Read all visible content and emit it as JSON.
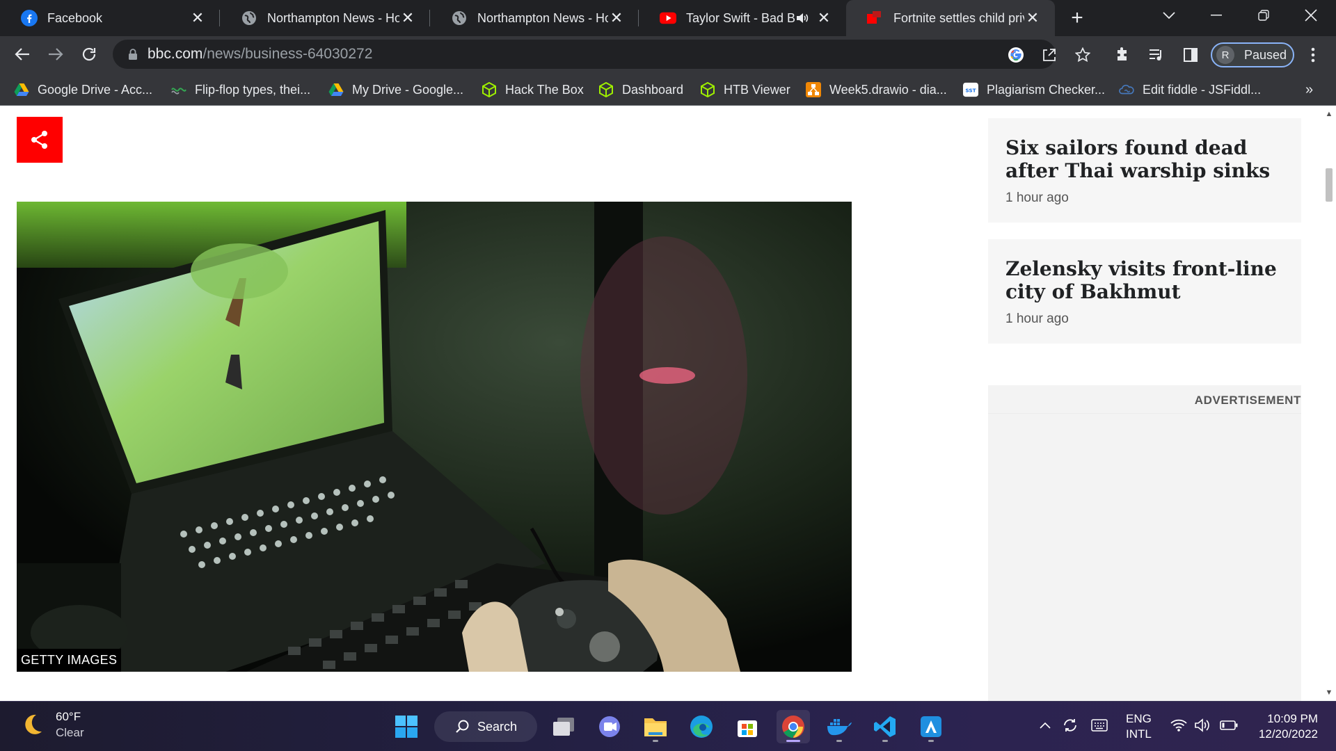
{
  "browser": {
    "tabs": [
      {
        "title": "Facebook",
        "icon": "facebook-icon",
        "active": false
      },
      {
        "title": "Northampton News - Hom",
        "icon": "globe-icon",
        "active": false
      },
      {
        "title": "Northampton News - Hom",
        "icon": "globe-icon",
        "active": false
      },
      {
        "title": "Taylor Swift - Bad Blo",
        "icon": "youtube-icon",
        "active": false,
        "audio": true
      },
      {
        "title": "Fortnite settles child priva",
        "icon": "bbc-icon",
        "active": true
      }
    ],
    "url_host": "bbc.com",
    "url_path": "/news/business-64030272",
    "profile_initial": "R",
    "profile_status": "Paused"
  },
  "bookmarks": [
    {
      "label": "Google Drive - Acc...",
      "icon": "google-drive-icon"
    },
    {
      "label": "Flip-flop types, thei...",
      "icon": "link-icon"
    },
    {
      "label": "My Drive - Google...",
      "icon": "google-drive-icon"
    },
    {
      "label": "Hack The Box",
      "icon": "hackthebox-icon"
    },
    {
      "label": "Dashboard",
      "icon": "hackthebox-icon"
    },
    {
      "label": "HTB Viewer",
      "icon": "hackthebox-icon"
    },
    {
      "label": "Week5.drawio - dia...",
      "icon": "drawio-icon"
    },
    {
      "label": "Plagiarism Checker...",
      "icon": "sst-icon"
    },
    {
      "label": "Edit fiddle - JSFiddl...",
      "icon": "jsfiddle-icon"
    }
  ],
  "article": {
    "image_caption": "GETTY IMAGES"
  },
  "sidebar": {
    "stories": [
      {
        "title": "Six sailors found dead after Thai warship sinks",
        "time": "1 hour ago"
      },
      {
        "title": "Zelensky visits front-line city of Bakhmut",
        "time": "1 hour ago"
      }
    ],
    "ad_label": "ADVERTISEMENT"
  },
  "taskbar": {
    "weather_temp": "60°F",
    "weather_desc": "Clear",
    "search_label": "Search",
    "lang_line1": "ENG",
    "lang_line2": "INTL",
    "time": "10:09 PM",
    "date": "12/20/2022"
  },
  "colors": {
    "bbc_red": "#ff0000",
    "chrome_dark": "#202124",
    "chrome_toolbar": "#35363a",
    "profile_ring": "#8ab4f8"
  }
}
